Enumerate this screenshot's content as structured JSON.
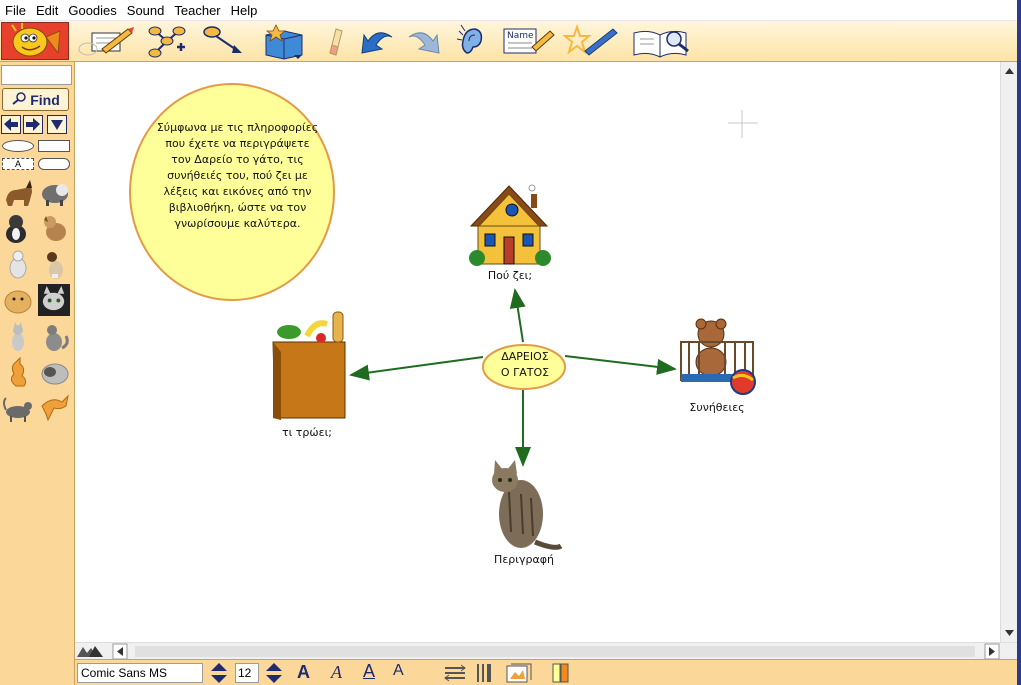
{
  "menu": [
    "File",
    "Edit",
    "Goodies",
    "Sound",
    "Teacher",
    "Help"
  ],
  "palette": {
    "search_value": "",
    "find_label": "Find",
    "text_tool_label": "A"
  },
  "map": {
    "note_text": "Σύμφωνα με τις πληροφορίες που έχετε να περιγράψετε τον Δαρείο το γάτο, τις συνήθειές του, πού ζει με λέξεις και εικόνες από την βιβλιοθήκη, ώστε να τον γνωρίσουμε καλύτερα.",
    "center_line1": "ΔΑΡΕΙΟΣ",
    "center_line2": "Ο ΓΑΤΟΣ",
    "node_house": "Πού ζει;",
    "node_food": "τι τρώει;",
    "node_habits": "Συνήθειες",
    "node_description": "Περιγραφή"
  },
  "formatbar": {
    "font_name": "Comic Sans MS",
    "font_size": "12",
    "bold_label": "A",
    "italic_label": "A",
    "underline_label": "A",
    "size_label": "A"
  },
  "colors": {
    "note_fill": "#ffff99",
    "note_border": "#e39b48",
    "arrow": "#1f6b1f",
    "palette_bg": "#fbd79a",
    "toolbar_bg": "#fde3a6"
  }
}
